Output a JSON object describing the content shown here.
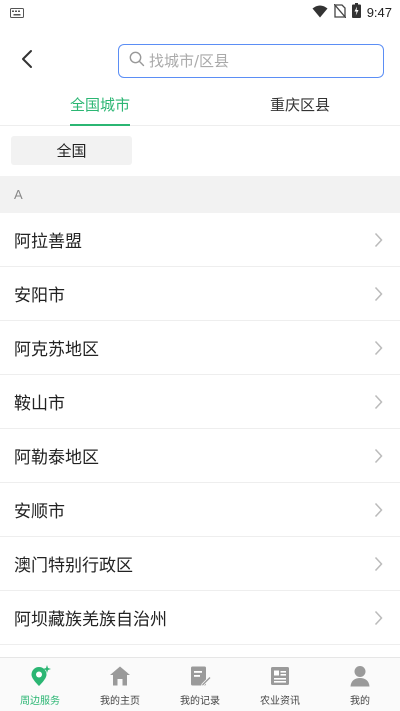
{
  "status_bar": {
    "time": "9:47",
    "icons": [
      "keyboard-icon",
      "wifi-icon",
      "no-sim-icon",
      "battery-charging-icon"
    ]
  },
  "header": {
    "back_icon": "chevron-left-icon",
    "search_placeholder": "找城市/区县"
  },
  "tabs": [
    {
      "label": "全国城市",
      "active": true
    },
    {
      "label": "重庆区县",
      "active": false
    }
  ],
  "all_chip": {
    "label": "全国"
  },
  "section": {
    "letter": "A"
  },
  "cities": [
    {
      "name": "阿拉善盟"
    },
    {
      "name": "安阳市"
    },
    {
      "name": "阿克苏地区"
    },
    {
      "name": "鞍山市"
    },
    {
      "name": "阿勒泰地区"
    },
    {
      "name": "安顺市"
    },
    {
      "name": "澳门特别行政区"
    },
    {
      "name": "阿坝藏族羌族自治州"
    }
  ],
  "bottom_nav": [
    {
      "label": "周边服务",
      "icon": "location-service-icon",
      "active": true
    },
    {
      "label": "我的主页",
      "icon": "home-icon",
      "active": false
    },
    {
      "label": "我的记录",
      "icon": "record-edit-icon",
      "active": false
    },
    {
      "label": "农业资讯",
      "icon": "news-icon",
      "active": false
    },
    {
      "label": "我的",
      "icon": "profile-icon",
      "active": false
    }
  ],
  "colors": {
    "accent": "#2bb673",
    "search_border": "#5b8ef5",
    "section_bg": "#f2f2f2",
    "nav_icon": "#9a9a9a"
  }
}
